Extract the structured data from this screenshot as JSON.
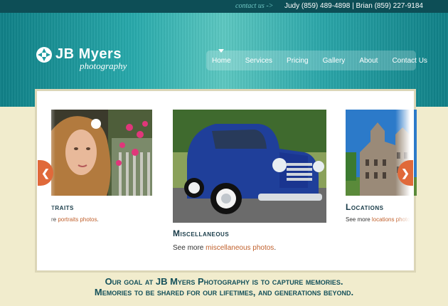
{
  "topbar": {
    "contact_link": "contact us ->",
    "phones": "Judy (859) 489-4898 | Brian (859) 227-9184"
  },
  "logo": {
    "name": "JB Myers",
    "sub": "photography"
  },
  "nav": {
    "items": [
      "Home",
      "Services",
      "Pricing",
      "Gallery",
      "About",
      "Contact Us"
    ],
    "active": "Home"
  },
  "slides": [
    {
      "title": "Portraits",
      "visible_title": "traits",
      "see_prefix": "re ",
      "link": "portraits photos",
      "suffix": "."
    },
    {
      "title": "Miscellaneous",
      "see_prefix": "See more ",
      "link": "miscellaneous photos",
      "suffix": "."
    },
    {
      "title": "Locations",
      "see_prefix": "See more ",
      "link": "locations photo",
      "suffix": ""
    }
  ],
  "tagline": {
    "line1": "Our goal at JB Myers Photography is to capture memories.",
    "line2": "Memories to be shared for our lifetimes, and generations beyond."
  },
  "colors": {
    "accent": "#e0693a",
    "link": "#c0602c",
    "heading": "#183b48",
    "header_teal": "#28a9ab",
    "topbar": "#0d4e56"
  },
  "icons": {
    "logo_mark": "aperture-icon",
    "prev": "chevron-left-icon",
    "next": "chevron-right-icon"
  }
}
